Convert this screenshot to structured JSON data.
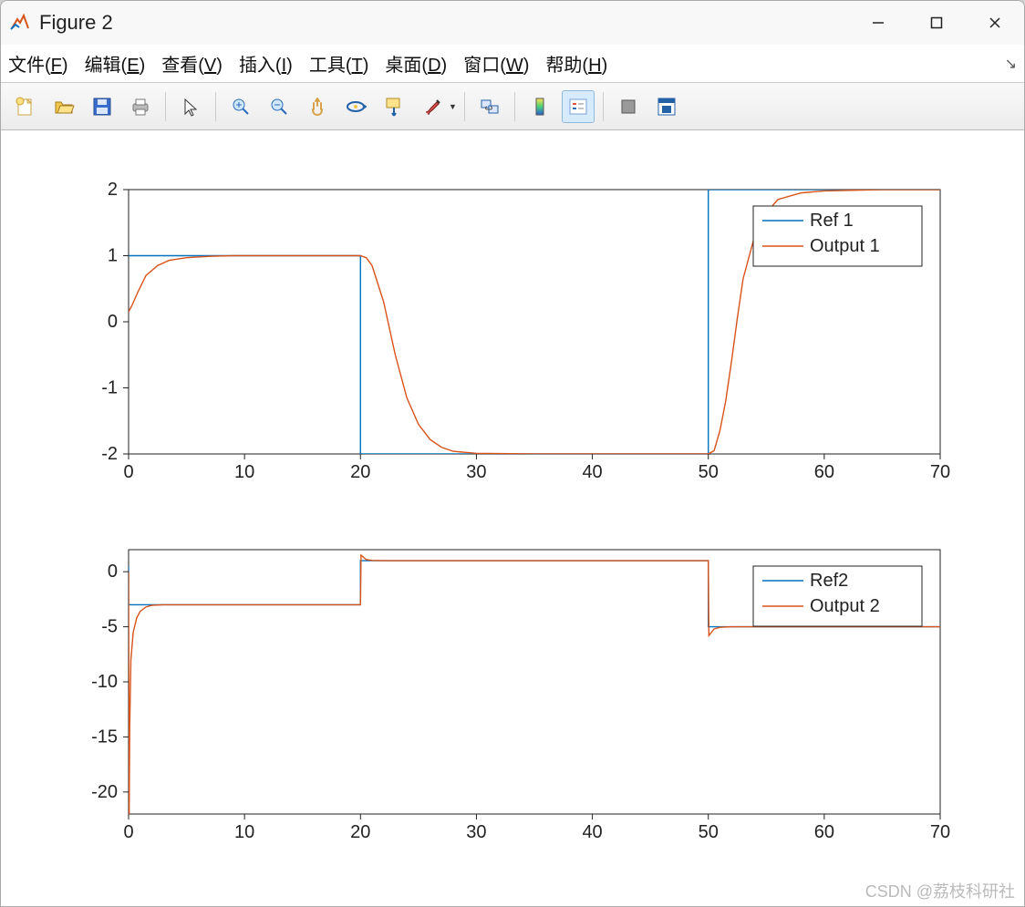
{
  "window": {
    "title": "Figure 2"
  },
  "menu": {
    "file": "文件(F)",
    "edit": "编辑(E)",
    "view": "查看(V)",
    "insert": "插入(I)",
    "tools": "工具(T)",
    "desktop": "桌面(D)",
    "window": "窗口(W)",
    "help": "帮助(H)"
  },
  "toolbar_icons": [
    "new-figure",
    "open",
    "save",
    "print",
    "|",
    "pointer",
    "|",
    "zoom-in",
    "zoom-out",
    "pan",
    "rotate3d",
    "data-cursor",
    "brush",
    "drop",
    "|",
    "link-axes",
    "|",
    "colorbar",
    "legend",
    "|",
    "grid",
    "dock"
  ],
  "watermark": "CSDN @荔枝科研社",
  "chart_data": [
    {
      "type": "line",
      "title": "",
      "xlabel": "",
      "ylabel": "",
      "xlim": [
        0,
        70
      ],
      "ylim": [
        -2,
        2
      ],
      "xticks": [
        0,
        10,
        20,
        30,
        40,
        50,
        60,
        70
      ],
      "yticks": [
        -2,
        -1,
        0,
        1,
        2
      ],
      "legend_pos": "upper right",
      "series": [
        {
          "name": "Ref 1",
          "color": "#0072bd",
          "x": [
            0,
            20,
            20,
            50,
            50,
            70
          ],
          "y": [
            1,
            1,
            -2,
            -2,
            2,
            2
          ]
        },
        {
          "name": "Output 1",
          "color": "#d95319",
          "x": [
            0,
            0.3,
            0.8,
            1.5,
            2.5,
            3.5,
            5,
            7,
            9,
            12,
            15,
            18,
            20,
            20.5,
            21,
            22,
            23,
            24,
            25,
            26,
            27,
            28,
            30,
            35,
            40,
            45,
            50,
            50.5,
            51,
            51.5,
            52,
            52.5,
            53,
            54,
            55,
            56,
            58,
            60,
            65,
            70
          ],
          "y": [
            0.15,
            0.25,
            0.45,
            0.7,
            0.85,
            0.93,
            0.97,
            0.99,
            1.0,
            1.0,
            1.0,
            1.0,
            1.0,
            0.97,
            0.85,
            0.3,
            -0.5,
            -1.15,
            -1.55,
            -1.78,
            -1.9,
            -1.96,
            -1.99,
            -2.0,
            -2.0,
            -2.0,
            -2.0,
            -1.95,
            -1.65,
            -1.2,
            -0.6,
            0.05,
            0.65,
            1.3,
            1.65,
            1.85,
            1.95,
            1.98,
            2.0,
            2.0
          ]
        }
      ]
    },
    {
      "type": "line",
      "title": "",
      "xlabel": "",
      "ylabel": "",
      "xlim": [
        0,
        70
      ],
      "ylim": [
        -22,
        2
      ],
      "xticks": [
        0,
        10,
        20,
        30,
        40,
        50,
        60,
        70
      ],
      "yticks": [
        -20,
        -15,
        -10,
        -5,
        0
      ],
      "legend_pos": "upper right",
      "series": [
        {
          "name": "Ref2",
          "color": "#0072bd",
          "x": [
            0,
            0,
            20,
            20,
            50,
            50,
            70
          ],
          "y": [
            0.5,
            -3,
            -3,
            1,
            1,
            -5,
            -5
          ]
        },
        {
          "name": "Output 2",
          "color": "#d95319",
          "x": [
            0,
            0.05,
            0.1,
            0.2,
            0.4,
            0.7,
            1.0,
            1.5,
            2,
            3,
            5,
            10,
            15,
            20,
            20.05,
            20.5,
            21,
            22,
            25,
            30,
            40,
            50,
            50.05,
            50.5,
            51,
            52,
            55,
            60,
            70
          ],
          "y": [
            0,
            -22,
            -14,
            -8,
            -5.5,
            -4.2,
            -3.6,
            -3.2,
            -3.05,
            -3.0,
            -3.0,
            -3.0,
            -3.0,
            -3.0,
            1.5,
            1.1,
            1.02,
            1.0,
            1.0,
            1.0,
            1.0,
            1.0,
            -5.8,
            -5.2,
            -5.05,
            -5.0,
            -5.0,
            -5.0,
            -5.0
          ]
        }
      ]
    }
  ]
}
